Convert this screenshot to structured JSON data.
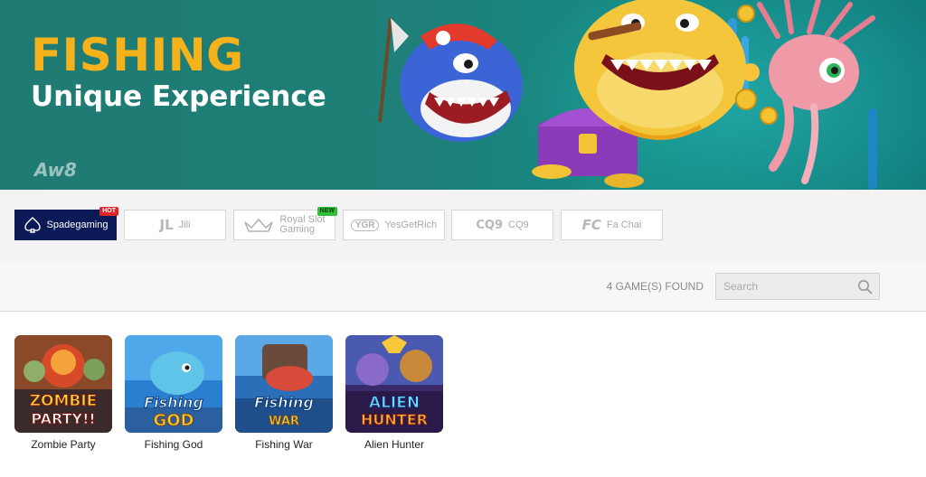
{
  "banner": {
    "title": "FISHING",
    "subtitle": "Unique Experience",
    "logo": "Aw8",
    "colors": {
      "title": "#f5b21a",
      "background": "#1f7a72"
    }
  },
  "providers": [
    {
      "name": "Spadegaming",
      "logo": "spade-icon",
      "active": true,
      "badge": "HOT"
    },
    {
      "name": "Jili",
      "logo_text": "JL",
      "active": false
    },
    {
      "name_line1": "Royal Slot",
      "name_line2": "Gaming",
      "logo": "crown-icon",
      "active": false,
      "badge": "NEW"
    },
    {
      "name": "YesGetRich",
      "logo_text": "YGR",
      "active": false
    },
    {
      "name": "CQ9",
      "logo_text": "CQ9",
      "active": false
    },
    {
      "name": "Fa Chai",
      "logo_text": "FC",
      "active": false
    }
  ],
  "search": {
    "found_text": "4 GAME(S) FOUND",
    "placeholder": "Search"
  },
  "games": [
    {
      "name": "Zombie Party",
      "art_line1": "ZOMBIE",
      "art_line2": "PARTY!!"
    },
    {
      "name": "Fishing God",
      "art_line1": "Fishing",
      "art_line2": "GOD"
    },
    {
      "name": "Fishing War",
      "art_line1": "Fishing",
      "art_line2": "WAR"
    },
    {
      "name": "Alien Hunter",
      "art_line1": "ALIEN",
      "art_line2": "HUNTER"
    }
  ],
  "colors": {
    "active_tab": "#0b1a57",
    "hot_badge": "#e0262b",
    "new_badge": "#2fbf3a"
  }
}
